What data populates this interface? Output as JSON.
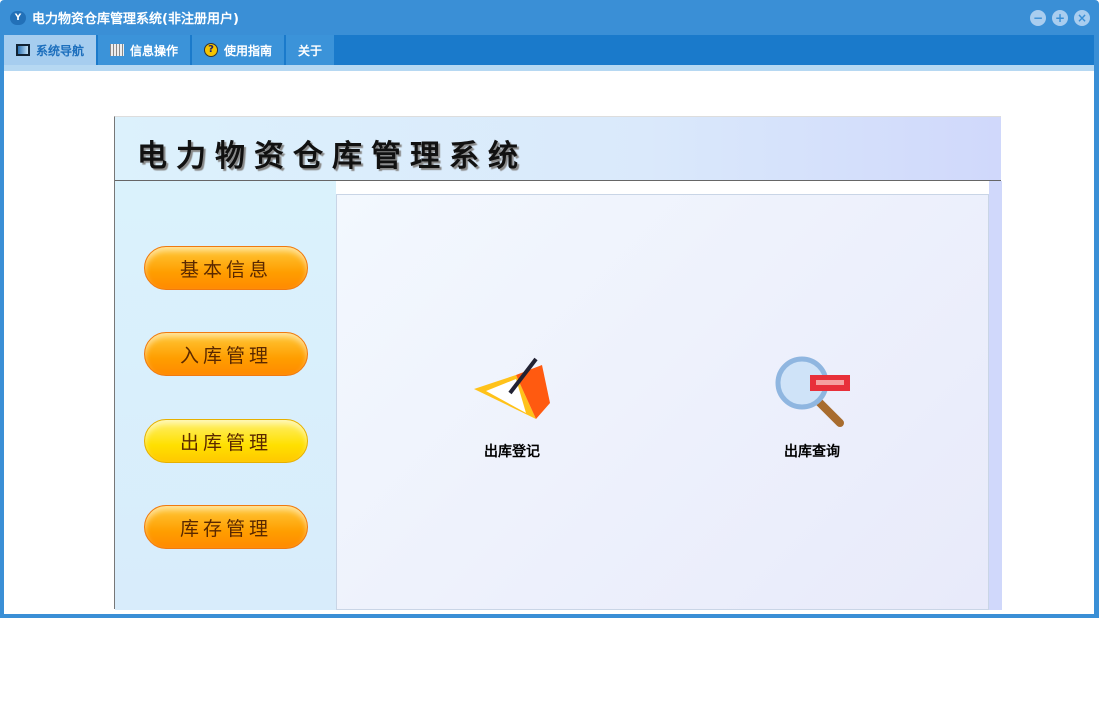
{
  "window": {
    "title": "电力物资仓库管理系统(非注册用户)"
  },
  "tabs": [
    {
      "label": "系统导航",
      "icon": "monitor-icon"
    },
    {
      "label": "信息操作",
      "icon": "grid-icon"
    },
    {
      "label": "使用指南",
      "icon": "help-icon"
    },
    {
      "label": "关于"
    }
  ],
  "header": {
    "title": "电力物资仓库管理系统"
  },
  "nav": [
    "基本信息",
    "入库管理",
    "出库管理",
    "库存管理"
  ],
  "actions": [
    {
      "label": "出库登记",
      "icon": "folder-pen-icon"
    },
    {
      "label": "出库查询",
      "icon": "magnifier-icon"
    }
  ]
}
